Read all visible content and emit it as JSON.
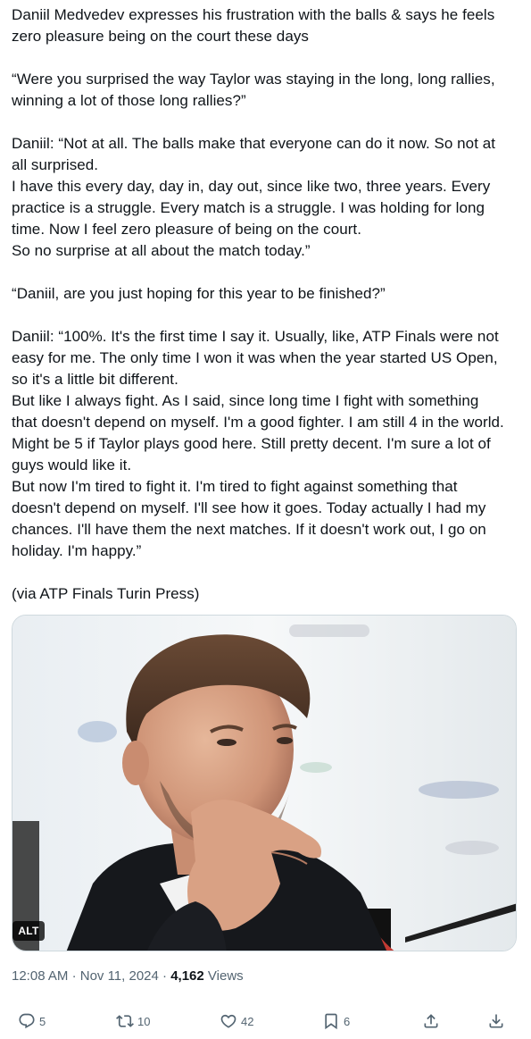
{
  "tweet": {
    "paragraphs": [
      {
        "lines": [
          "Daniil Medvedev expresses his frustration  with the balls & says he feels",
          "zero pleasure being on the court these days"
        ]
      },
      {
        "lines": [
          "“Were you surprised the way Taylor was staying in the long, long rallies,",
          "winning a lot of those long rallies?”"
        ]
      },
      {
        "lines": [
          "Daniil: “Not at all. The balls make that everyone can do it now. So not at",
          "all surprised.",
          "I have this every day, day in, day out, since like two, three years. Every",
          "practice is a struggle. Every match is a struggle. I was holding for long",
          "time. Now I feel zero pleasure of being on the court.",
          "So no surprise at all about the match today.”"
        ]
      },
      {
        "lines": [
          "“Daniil, are you just hoping for this year to be finished?”"
        ]
      },
      {
        "lines": [
          "Daniil: “100%. It's the first time I say it. Usually, like, ATP Finals were not",
          "easy for me. The only time I won it was when the year started US Open,",
          "so it's a little bit different.",
          "But like I always fight. As I said, since long time I fight with something",
          "that doesn't depend on myself. I'm a good fighter. I am still 4 in the world.",
          "Might be 5 if Taylor plays good here. Still pretty decent. I'm sure a lot of",
          "guys would like it.",
          "But now I'm tired to fight it. I'm tired to fight against something that",
          "doesn't depend on myself. I'll see how it goes. Today actually I had my",
          "chances. I'll have them the next matches. If it doesn't work out, I go on",
          "holiday. I'm happy.”"
        ]
      },
      {
        "lines": [
          "(via ATP Finals Turin Press)"
        ]
      }
    ]
  },
  "media": {
    "alt_badge": "ALT",
    "icon": "photo"
  },
  "meta": {
    "time": "12:08 AM",
    "separator": "·",
    "date": "Nov 11, 2024",
    "views_count": "4,162",
    "views_label": "Views"
  },
  "actions": [
    {
      "name": "reply",
      "icon": "reply-icon",
      "count": "5"
    },
    {
      "name": "retweet",
      "icon": "retweet-icon",
      "count": "10"
    },
    {
      "name": "like",
      "icon": "heart-icon",
      "count": "42"
    },
    {
      "name": "bookmark",
      "icon": "bookmark-icon",
      "count": "6"
    },
    {
      "name": "share",
      "icon": "share-icon",
      "count": ""
    },
    {
      "name": "download",
      "icon": "download-icon",
      "count": ""
    }
  ],
  "colors": {
    "text": "#0f1419",
    "secondary": "#536471",
    "border": "#cfd9de"
  }
}
